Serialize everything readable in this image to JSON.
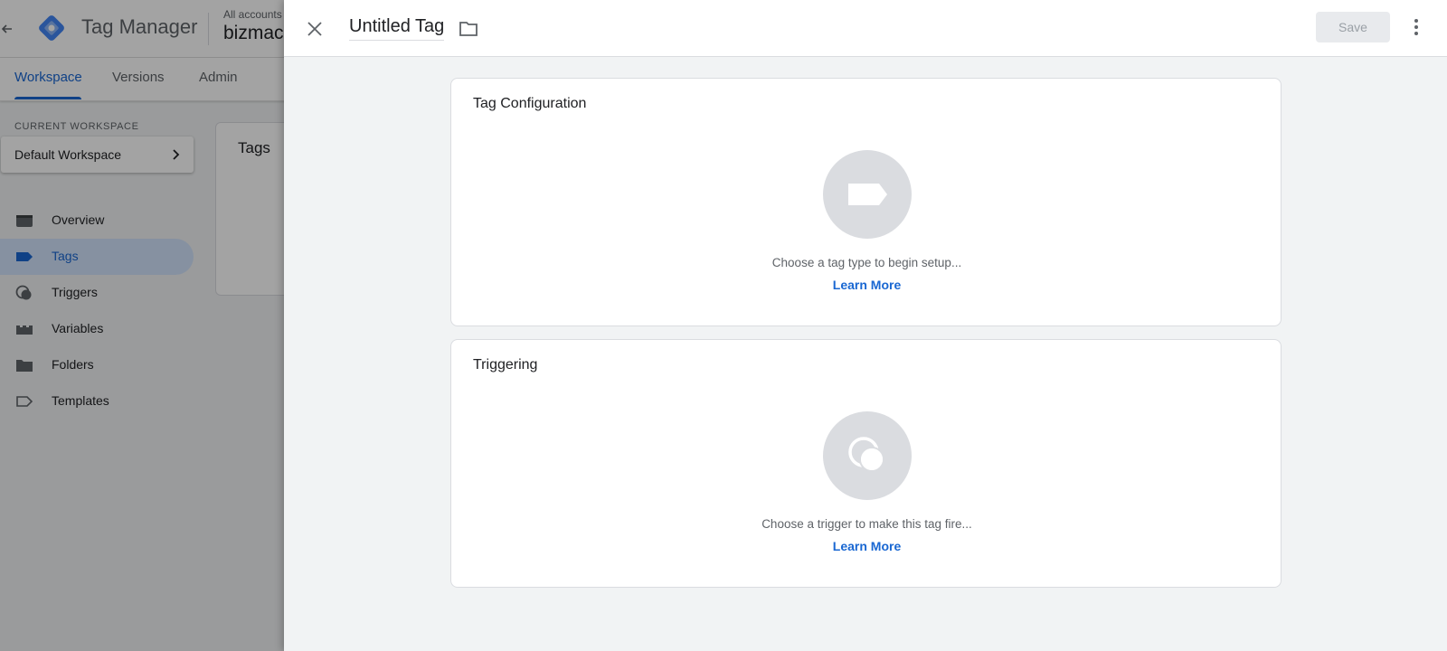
{
  "app": {
    "product_name": "Tag Manager",
    "accounts_label": "All accounts",
    "container_name": "bizmac"
  },
  "nav_tabs": [
    {
      "label": "Workspace",
      "active": true
    },
    {
      "label": "Versions",
      "active": false
    },
    {
      "label": "Admin",
      "active": false
    }
  ],
  "workspace": {
    "section_label": "CURRENT WORKSPACE",
    "selected": "Default Workspace"
  },
  "sidebar": {
    "items": [
      {
        "label": "Overview",
        "icon": "overview-icon",
        "active": false
      },
      {
        "label": "Tags",
        "icon": "tag-icon",
        "active": true
      },
      {
        "label": "Triggers",
        "icon": "trigger-icon",
        "active": false
      },
      {
        "label": "Variables",
        "icon": "variables-icon",
        "active": false
      },
      {
        "label": "Folders",
        "icon": "folder-icon",
        "active": false
      },
      {
        "label": "Templates",
        "icon": "template-icon",
        "active": false
      }
    ]
  },
  "background_card": {
    "title": "Tags"
  },
  "sheet": {
    "tag_name": "Untitled Tag",
    "save_label": "Save",
    "panels": {
      "config": {
        "title": "Tag Configuration",
        "hint": "Choose a tag type to begin setup...",
        "link": "Learn More"
      },
      "trigger": {
        "title": "Triggering",
        "hint": "Choose a trigger to make this tag fire...",
        "link": "Learn More"
      }
    }
  },
  "colors": {
    "accent": "#1967d2",
    "active_nav_bg": "#d2e3fc",
    "icon_circle": "#dadce0",
    "sheet_bg": "#f1f3f4"
  }
}
